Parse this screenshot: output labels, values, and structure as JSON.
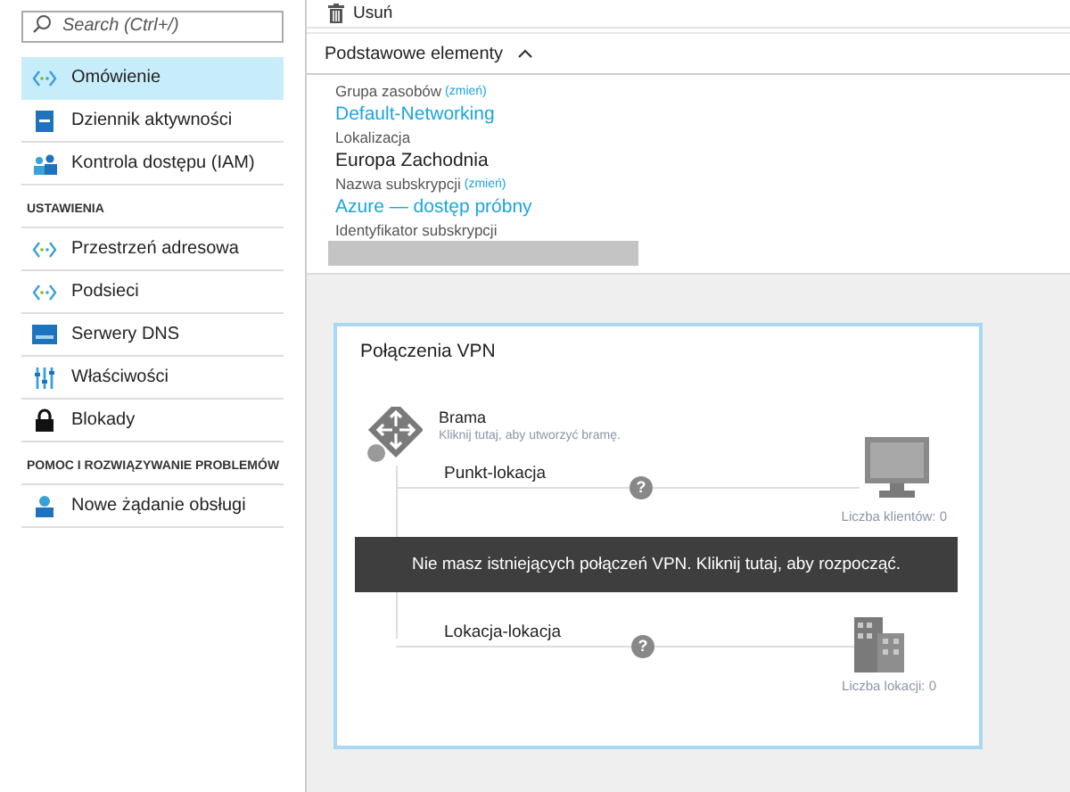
{
  "sidebar": {
    "search": {
      "placeholder": "Search (Ctrl+/)"
    },
    "groups": [
      {
        "items": [
          {
            "label": "Omówienie",
            "selected": true
          },
          {
            "label": "Dziennik aktywności",
            "selected": false
          },
          {
            "label": "Kontrola dostępu (IAM)",
            "selected": false
          }
        ]
      },
      {
        "title": "USTAWIENIA",
        "items": [
          {
            "label": "Przestrzeń adresowa",
            "selected": false
          },
          {
            "label": "Podsieci",
            "selected": false
          },
          {
            "label": "Serwery DNS",
            "selected": false
          },
          {
            "label": "Właściwości",
            "selected": false
          },
          {
            "label": "Blokady",
            "selected": false
          }
        ]
      },
      {
        "title": "POMOC I ROZWIĄZYWANIE PROBLEMÓW",
        "items": [
          {
            "label": "Nowe żądanie obsługi",
            "selected": false
          }
        ]
      }
    ]
  },
  "toolbar": {
    "delete_label": "Usuń"
  },
  "essentials": {
    "title": "Podstawowe elementy",
    "expanded": true,
    "fields": [
      {
        "label": "Grupa zasobów",
        "change": "(zmień)",
        "value": "Default-Networking",
        "kind": "link"
      },
      {
        "label": "Lokalizacja",
        "value": "Europa Zachodnia",
        "kind": "text"
      },
      {
        "label": "Nazwa subskrypcji",
        "change": "(zmień)",
        "value": "Azure — dostęp próbny",
        "kind": "link"
      },
      {
        "label": "Identyfikator subskrypcji",
        "kind": "redacted"
      }
    ]
  },
  "vpn": {
    "title": "Połączenia VPN",
    "gateway_title": "Brama",
    "gateway_hint": "Kliknij tutaj, aby utworzyć bramę.",
    "point_to_site": "Punkt-lokacja",
    "point_help": "?",
    "clients_count": "Liczba klientów: 0",
    "site_to_site": "Lokacja-lokacja",
    "site_help": "?",
    "sites_count": "Liczba lokacji: 0",
    "notice": "Nie masz istniejących połączeń VPN. Kliknij tutaj, aby rozpocząć."
  }
}
